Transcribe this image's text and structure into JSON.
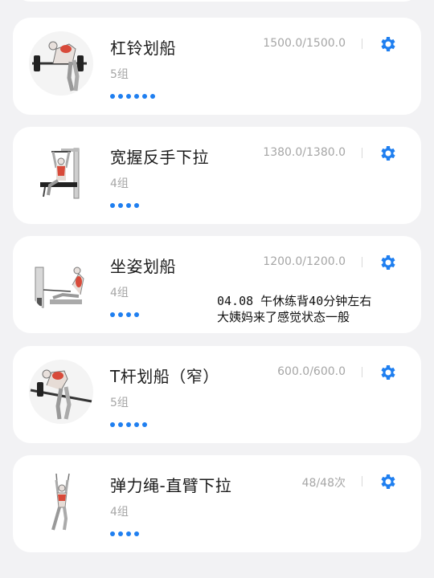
{
  "exercises": [
    {
      "name": "杠铃划船",
      "sets": "5组",
      "volume": "1500.0/1500.0",
      "dot_count": 6,
      "image": "barbell-row-figure"
    },
    {
      "name": "宽握反手下拉",
      "sets": "4组",
      "volume": "1380.0/1380.0",
      "dot_count": 4,
      "image": "lat-pulldown-figure"
    },
    {
      "name": "坐姿划船",
      "sets": "4组",
      "volume": "1200.0/1200.0",
      "dot_count": 4,
      "image": "seated-row-figure"
    },
    {
      "name": "T杆划船（窄）",
      "sets": "5组",
      "volume": "600.0/600.0",
      "dot_count": 5,
      "image": "t-bar-row-figure"
    },
    {
      "name": "弹力绳-直臂下拉",
      "sets": "4组",
      "volume": "48/48次",
      "dot_count": 4,
      "image": "band-straight-arm-pulldown-figure"
    }
  ],
  "note": {
    "line1": "04.08 午休练背40分钟左右",
    "line2": "大姨妈来了感觉状态一般"
  },
  "colors": {
    "accent": "#1f7ff0",
    "background": "#f2f2f4",
    "card": "#ffffff",
    "muted_text": "#a6a6a6"
  },
  "icons": {
    "settings": "gear-icon"
  }
}
